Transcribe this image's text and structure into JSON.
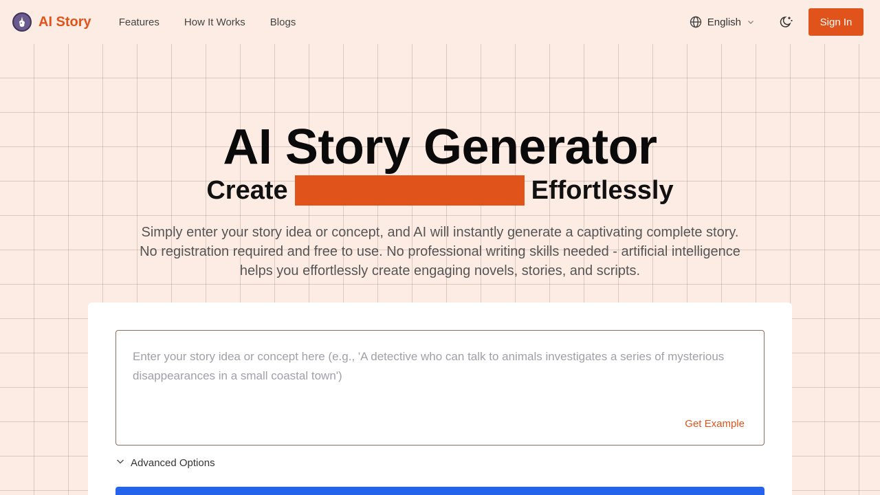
{
  "header": {
    "brand": "AI Story",
    "nav": [
      "Features",
      "How It Works",
      "Blogs"
    ],
    "language": "English",
    "sign_in": "Sign In",
    "icons": {
      "logo": "unicorn-logo-icon",
      "language": "globe-icon",
      "language_caret": "chevron-down-icon",
      "theme": "moon-stars-icon"
    }
  },
  "hero": {
    "title": "AI Story Generator",
    "subtitle_before": "Create",
    "subtitle_after": "Effortlessly",
    "description": "Simply enter your story idea or concept, and AI will instantly generate a captivating complete story. No registration required and free to use. No professional writing skills needed - artificial intelligence helps you effortlessly create engaging novels, stories, and scripts."
  },
  "form": {
    "placeholder": "Enter your story idea or concept here (e.g., 'A detective who can talk to animals investigates a series of mysterious disappearances in a small coastal town')",
    "get_example": "Get Example",
    "advanced_options": "Advanced Options"
  },
  "colors": {
    "accent": "#e0531a",
    "background": "#fdece4",
    "primary_button": "#2563eb"
  }
}
